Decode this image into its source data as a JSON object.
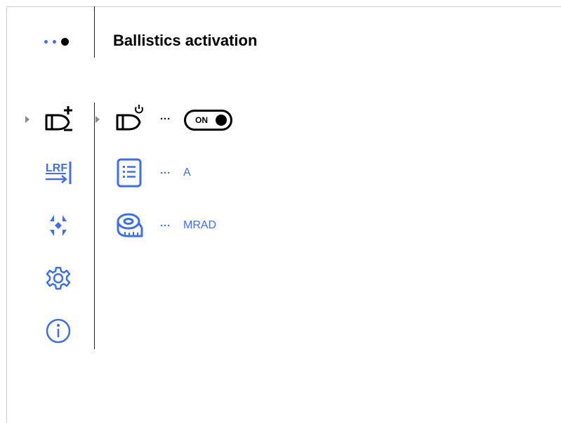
{
  "header": {
    "title": "Ballistics activation",
    "page_indicator": {
      "count": 3,
      "active_index": 2
    }
  },
  "sidebar": {
    "items": [
      {
        "name": "ballistics-add",
        "icon": "bullet-plus-minus-icon",
        "selected": true
      },
      {
        "name": "rangefinder",
        "icon": "lrf-icon",
        "text": "LRF"
      },
      {
        "name": "zeroing",
        "icon": "crosshair-arrows-icon"
      },
      {
        "name": "settings",
        "icon": "gear-icon"
      },
      {
        "name": "info",
        "icon": "info-icon"
      }
    ]
  },
  "options": [
    {
      "name": "ballistics-activation",
      "icon": "bullet-power-icon",
      "ellipsis": "···",
      "toggle": {
        "label": "ON",
        "state": true
      }
    },
    {
      "name": "ballistic-profile",
      "icon": "list-document-icon",
      "ellipsis": "···",
      "value": "A"
    },
    {
      "name": "units",
      "icon": "measuring-tape-icon",
      "ellipsis": "···",
      "value": "MRAD"
    }
  ],
  "colors": {
    "accent": "#3f6fe6",
    "text": "#000000",
    "divider": "#222222",
    "caret": "#8a8a8a"
  }
}
